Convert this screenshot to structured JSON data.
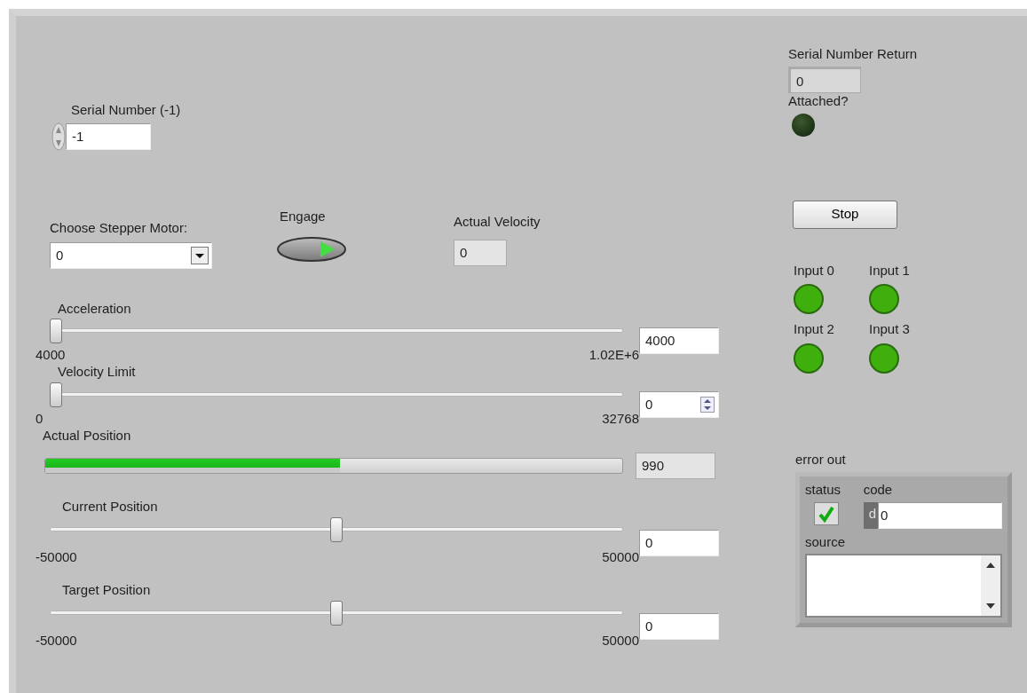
{
  "serial_number": {
    "label": "Serial Number (-1)",
    "value": "-1"
  },
  "stepper_motor": {
    "label": "Choose Stepper Motor:",
    "value": "0"
  },
  "engage": {
    "label": "Engage",
    "on": true
  },
  "actual_velocity": {
    "label": "Actual Velocity",
    "value": "0"
  },
  "sliders": [
    {
      "kind": "slider",
      "label": "Acceleration",
      "level": 0,
      "value": "4000",
      "min": "4000",
      "max": "1.02E+6",
      "spin": false
    },
    {
      "kind": "slider",
      "label": "Velocity Limit",
      "level": 0,
      "value": "0",
      "min": "0",
      "max": "32768",
      "spin": true
    },
    {
      "kind": "progress",
      "label": "Actual Position",
      "level": 0.51,
      "value": "990"
    },
    {
      "kind": "slider",
      "label": "Current Position",
      "level": 0.5,
      "value": "0",
      "min": "-50000",
      "max": "50000",
      "spin": false
    },
    {
      "kind": "slider",
      "label": "Target Position",
      "level": 0.5,
      "value": "0",
      "min": "-50000",
      "max": "50000",
      "spin": false
    }
  ],
  "serial_number_return": {
    "label": "Serial Number Return",
    "value": "0"
  },
  "attached": {
    "label": "Attached?",
    "on": false
  },
  "stop_button": {
    "label": "Stop"
  },
  "inputs": [
    {
      "label": "Input 0",
      "on": true
    },
    {
      "label": "Input 1",
      "on": true
    },
    {
      "label": "Input 2",
      "on": true
    },
    {
      "label": "Input 3",
      "on": true
    }
  ],
  "error_out": {
    "label": "error out",
    "status_label": "status",
    "status_ok": true,
    "code_label": "code",
    "radix": "d",
    "code": "0",
    "source_label": "source"
  }
}
